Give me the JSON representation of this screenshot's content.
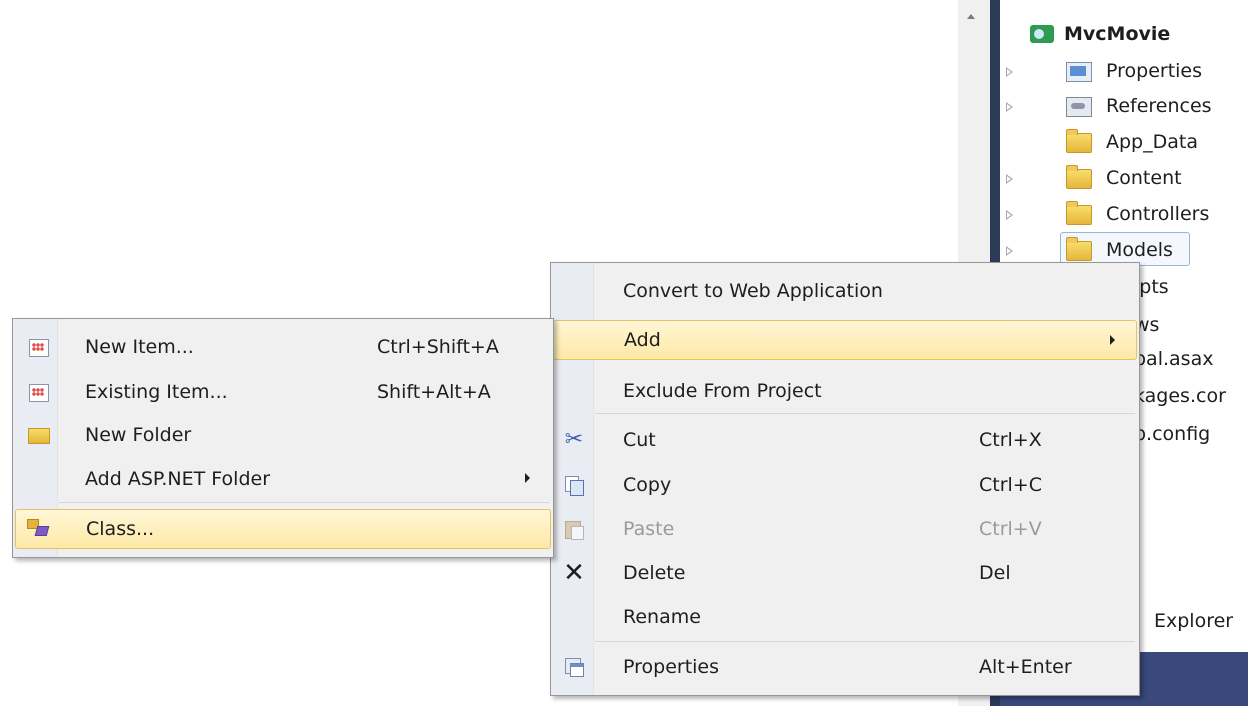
{
  "solution_explorer": {
    "items": [
      {
        "label": "MvcMovie",
        "icon": "csharp-project-icon",
        "expander": false,
        "bold": true
      },
      {
        "label": "Properties",
        "icon": "properties-icon",
        "expander": true
      },
      {
        "label": "References",
        "icon": "references-icon",
        "expander": true
      },
      {
        "label": "App_Data",
        "icon": "folder-icon",
        "expander": false
      },
      {
        "label": "Content",
        "icon": "folder-icon",
        "expander": true
      },
      {
        "label": "Controllers",
        "icon": "folder-icon",
        "expander": true
      },
      {
        "label": "Models",
        "icon": "folder-icon",
        "expander": true,
        "selected": true
      },
      {
        "label": "ipts"
      },
      {
        "label": "ws"
      },
      {
        "label": "bal.asax"
      },
      {
        "label": "kages.cor"
      },
      {
        "label": "b.config"
      }
    ],
    "footer_tab": "Explorer"
  },
  "context_menu": {
    "items": [
      {
        "label": "Convert to Web Application"
      },
      {
        "label": "Add",
        "submenu": true,
        "highlighted": true
      },
      {
        "label": "Exclude From Project"
      },
      {
        "label": "Cut",
        "shortcut": "Ctrl+X",
        "icon": "cut-icon"
      },
      {
        "label": "Copy",
        "shortcut": "Ctrl+C",
        "icon": "copy-icon"
      },
      {
        "label": "Paste",
        "shortcut": "Ctrl+V",
        "icon": "paste-icon",
        "disabled": true
      },
      {
        "label": "Delete",
        "shortcut": "Del",
        "icon": "delete-icon"
      },
      {
        "label": "Rename"
      },
      {
        "label": "Properties",
        "shortcut": "Alt+Enter",
        "icon": "properties-icon"
      }
    ]
  },
  "add_submenu": {
    "items": [
      {
        "label": "New Item...",
        "shortcut": "Ctrl+Shift+A",
        "icon": "new-item-icon"
      },
      {
        "label": "Existing Item...",
        "shortcut": "Shift+Alt+A",
        "icon": "existing-item-icon"
      },
      {
        "label": "New Folder",
        "icon": "new-folder-icon"
      },
      {
        "label": "Add ASP.NET Folder",
        "submenu": true
      },
      {
        "label": "Class...",
        "icon": "class-icon",
        "highlighted": true
      }
    ]
  },
  "colors": {
    "menu_background": "#f0f0f0",
    "highlight_gradient_top": "#fff6d6",
    "highlight_gradient_bottom": "#fde9a6",
    "explorer_dark_bar": "#2b3a55",
    "explorer_footer": "#38497a"
  }
}
